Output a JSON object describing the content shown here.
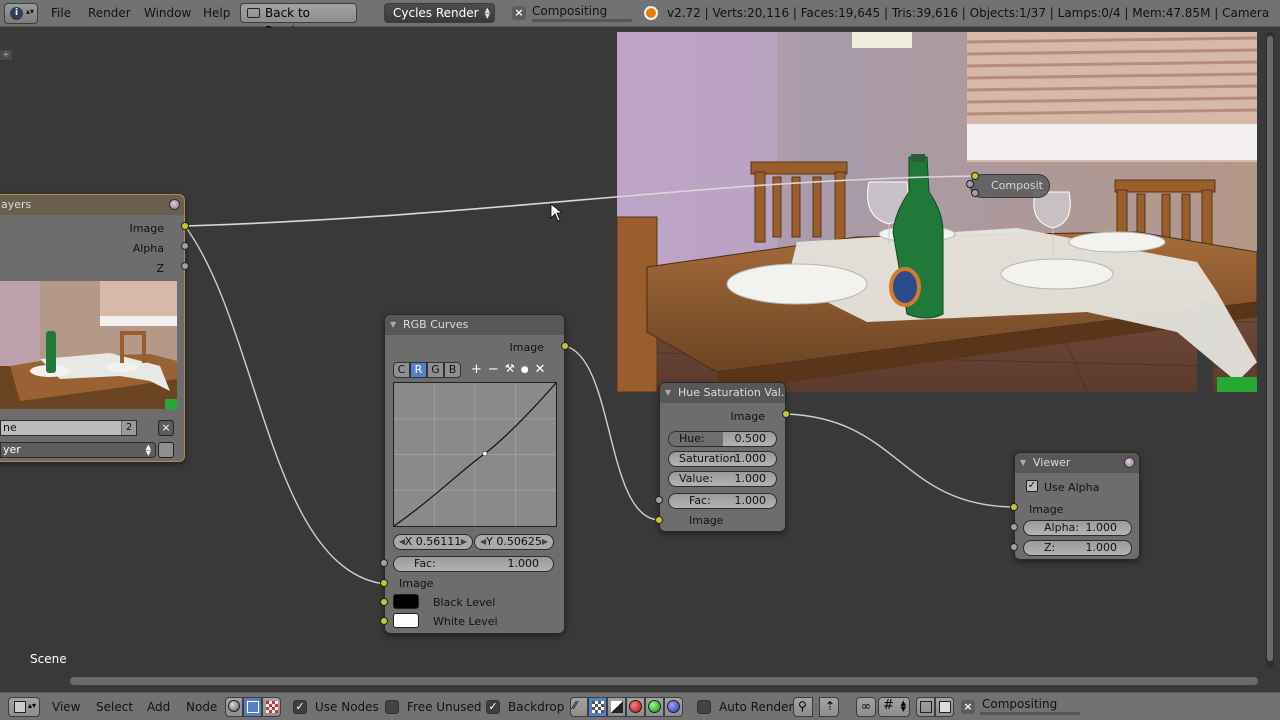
{
  "header": {
    "menus": [
      "File",
      "Render",
      "Window",
      "Help"
    ],
    "back_button": "Back to Previous",
    "render_engine": "Cycles Render",
    "job_label": "Compositing",
    "stats": "v2.72 | Verts:20,116 | Faces:19,645 | Tris:39,616 | Objects:1/37 | Lamps:0/4 | Mem:47.85M | Camera"
  },
  "editor": {
    "scene_label": "Scene",
    "noodles_color": "#c8c8c8"
  },
  "render_layers_node": {
    "title": "ayers",
    "outputs": [
      "Image",
      "Alpha",
      "Z"
    ],
    "scene_field": "ne",
    "scene_users": "2",
    "layer_field": "yer"
  },
  "rgb_curves_node": {
    "title": "RGB Curves",
    "output": "Image",
    "channel_tabs": [
      "C",
      "R",
      "G",
      "B"
    ],
    "active_channel": "R",
    "tools": [
      "+",
      "−",
      "🔧",
      "●",
      "✕"
    ],
    "x_value": "X 0.56111",
    "y_value": "Y 0.50625",
    "fac_label": "Fac:",
    "fac_value": "1.000",
    "inputs": [
      "Image",
      "Black Level",
      "White Level"
    ],
    "black_color": "#000000",
    "white_color": "#ffffff"
  },
  "hsv_node": {
    "title": "Hue Saturation Val...",
    "output": "Image",
    "fields": [
      {
        "label": "Hue:",
        "value": "0.500",
        "fraction": 0.5
      },
      {
        "label": "Saturation:",
        "value": "1.000",
        "fraction": 1.0
      },
      {
        "label": "Value:",
        "value": "1.000",
        "fraction": 1.0
      }
    ],
    "fac_label": "Fac:",
    "fac_value": "1.000",
    "input": "Image"
  },
  "viewer_node": {
    "title": "Viewer",
    "use_alpha_label": "Use Alpha",
    "use_alpha": true,
    "input": "Image",
    "alpha_label": "Alpha:",
    "alpha_value": "1.000",
    "z_label": "Z:",
    "z_value": "1.000"
  },
  "composite_node": {
    "title": "Composit"
  },
  "footer": {
    "menus": [
      "View",
      "Select",
      "Add",
      "Node"
    ],
    "use_nodes_label": "Use Nodes",
    "use_nodes": true,
    "free_unused_label": "Free Unused",
    "free_unused": false,
    "backdrop_label": "Backdrop",
    "backdrop": true,
    "auto_render_label": "Auto Render",
    "auto_render": false,
    "job_label": "Compositing"
  }
}
